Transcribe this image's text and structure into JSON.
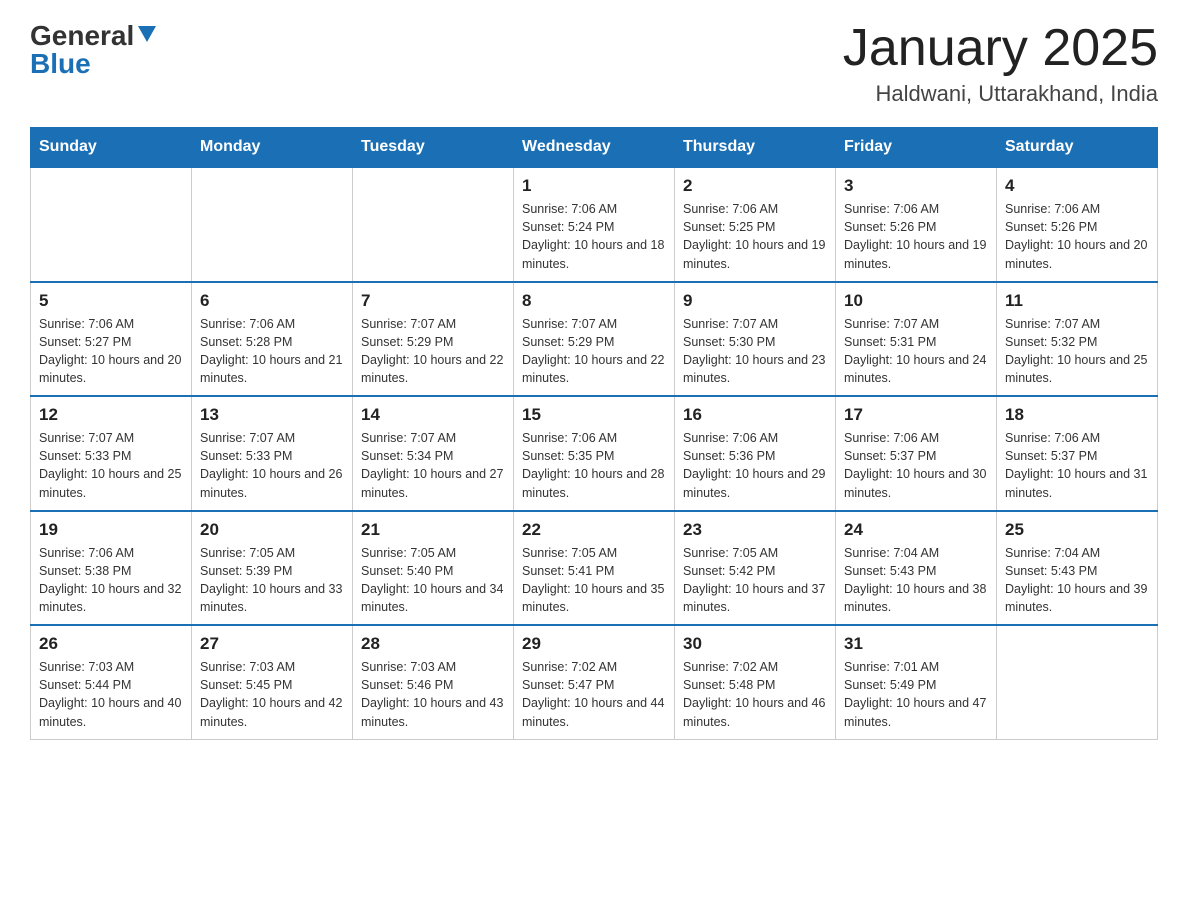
{
  "logo": {
    "general": "General",
    "blue": "Blue",
    "arrow": "▲"
  },
  "header": {
    "month": "January 2025",
    "location": "Haldwani, Uttarakhand, India"
  },
  "days_of_week": [
    "Sunday",
    "Monday",
    "Tuesday",
    "Wednesday",
    "Thursday",
    "Friday",
    "Saturday"
  ],
  "weeks": [
    [
      {
        "day": "",
        "info": ""
      },
      {
        "day": "",
        "info": ""
      },
      {
        "day": "",
        "info": ""
      },
      {
        "day": "1",
        "info": "Sunrise: 7:06 AM\nSunset: 5:24 PM\nDaylight: 10 hours and 18 minutes."
      },
      {
        "day": "2",
        "info": "Sunrise: 7:06 AM\nSunset: 5:25 PM\nDaylight: 10 hours and 19 minutes."
      },
      {
        "day": "3",
        "info": "Sunrise: 7:06 AM\nSunset: 5:26 PM\nDaylight: 10 hours and 19 minutes."
      },
      {
        "day": "4",
        "info": "Sunrise: 7:06 AM\nSunset: 5:26 PM\nDaylight: 10 hours and 20 minutes."
      }
    ],
    [
      {
        "day": "5",
        "info": "Sunrise: 7:06 AM\nSunset: 5:27 PM\nDaylight: 10 hours and 20 minutes."
      },
      {
        "day": "6",
        "info": "Sunrise: 7:06 AM\nSunset: 5:28 PM\nDaylight: 10 hours and 21 minutes."
      },
      {
        "day": "7",
        "info": "Sunrise: 7:07 AM\nSunset: 5:29 PM\nDaylight: 10 hours and 22 minutes."
      },
      {
        "day": "8",
        "info": "Sunrise: 7:07 AM\nSunset: 5:29 PM\nDaylight: 10 hours and 22 minutes."
      },
      {
        "day": "9",
        "info": "Sunrise: 7:07 AM\nSunset: 5:30 PM\nDaylight: 10 hours and 23 minutes."
      },
      {
        "day": "10",
        "info": "Sunrise: 7:07 AM\nSunset: 5:31 PM\nDaylight: 10 hours and 24 minutes."
      },
      {
        "day": "11",
        "info": "Sunrise: 7:07 AM\nSunset: 5:32 PM\nDaylight: 10 hours and 25 minutes."
      }
    ],
    [
      {
        "day": "12",
        "info": "Sunrise: 7:07 AM\nSunset: 5:33 PM\nDaylight: 10 hours and 25 minutes."
      },
      {
        "day": "13",
        "info": "Sunrise: 7:07 AM\nSunset: 5:33 PM\nDaylight: 10 hours and 26 minutes."
      },
      {
        "day": "14",
        "info": "Sunrise: 7:07 AM\nSunset: 5:34 PM\nDaylight: 10 hours and 27 minutes."
      },
      {
        "day": "15",
        "info": "Sunrise: 7:06 AM\nSunset: 5:35 PM\nDaylight: 10 hours and 28 minutes."
      },
      {
        "day": "16",
        "info": "Sunrise: 7:06 AM\nSunset: 5:36 PM\nDaylight: 10 hours and 29 minutes."
      },
      {
        "day": "17",
        "info": "Sunrise: 7:06 AM\nSunset: 5:37 PM\nDaylight: 10 hours and 30 minutes."
      },
      {
        "day": "18",
        "info": "Sunrise: 7:06 AM\nSunset: 5:37 PM\nDaylight: 10 hours and 31 minutes."
      }
    ],
    [
      {
        "day": "19",
        "info": "Sunrise: 7:06 AM\nSunset: 5:38 PM\nDaylight: 10 hours and 32 minutes."
      },
      {
        "day": "20",
        "info": "Sunrise: 7:05 AM\nSunset: 5:39 PM\nDaylight: 10 hours and 33 minutes."
      },
      {
        "day": "21",
        "info": "Sunrise: 7:05 AM\nSunset: 5:40 PM\nDaylight: 10 hours and 34 minutes."
      },
      {
        "day": "22",
        "info": "Sunrise: 7:05 AM\nSunset: 5:41 PM\nDaylight: 10 hours and 35 minutes."
      },
      {
        "day": "23",
        "info": "Sunrise: 7:05 AM\nSunset: 5:42 PM\nDaylight: 10 hours and 37 minutes."
      },
      {
        "day": "24",
        "info": "Sunrise: 7:04 AM\nSunset: 5:43 PM\nDaylight: 10 hours and 38 minutes."
      },
      {
        "day": "25",
        "info": "Sunrise: 7:04 AM\nSunset: 5:43 PM\nDaylight: 10 hours and 39 minutes."
      }
    ],
    [
      {
        "day": "26",
        "info": "Sunrise: 7:03 AM\nSunset: 5:44 PM\nDaylight: 10 hours and 40 minutes."
      },
      {
        "day": "27",
        "info": "Sunrise: 7:03 AM\nSunset: 5:45 PM\nDaylight: 10 hours and 42 minutes."
      },
      {
        "day": "28",
        "info": "Sunrise: 7:03 AM\nSunset: 5:46 PM\nDaylight: 10 hours and 43 minutes."
      },
      {
        "day": "29",
        "info": "Sunrise: 7:02 AM\nSunset: 5:47 PM\nDaylight: 10 hours and 44 minutes."
      },
      {
        "day": "30",
        "info": "Sunrise: 7:02 AM\nSunset: 5:48 PM\nDaylight: 10 hours and 46 minutes."
      },
      {
        "day": "31",
        "info": "Sunrise: 7:01 AM\nSunset: 5:49 PM\nDaylight: 10 hours and 47 minutes."
      },
      {
        "day": "",
        "info": ""
      }
    ]
  ]
}
